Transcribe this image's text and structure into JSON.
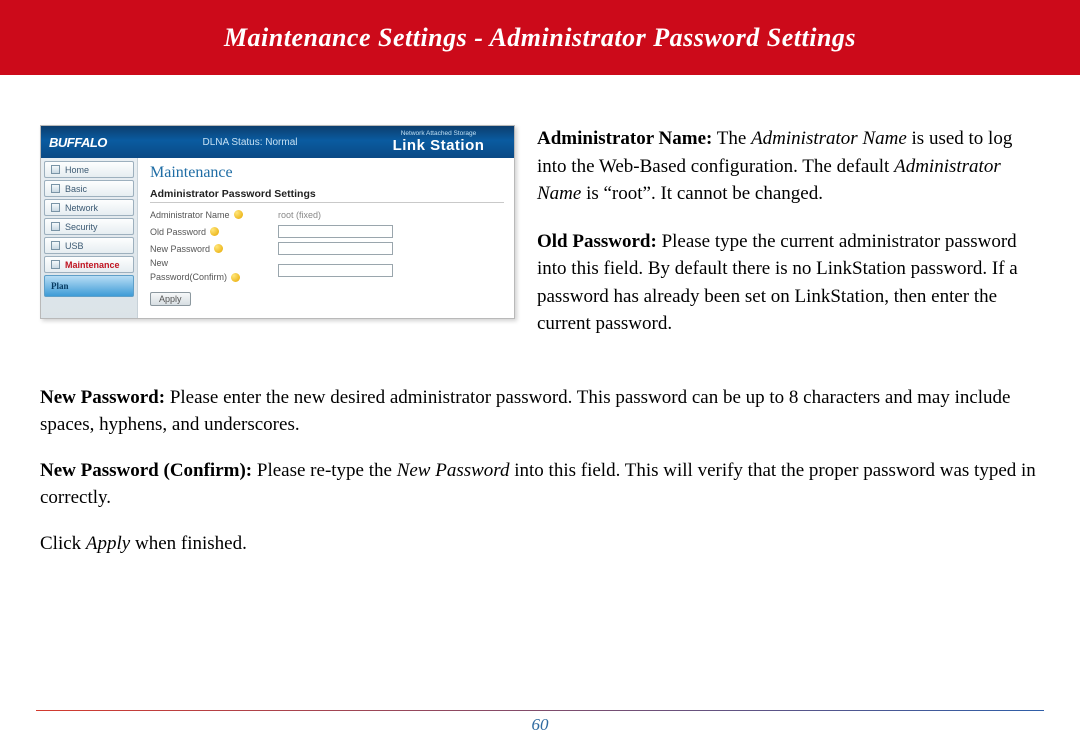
{
  "header": {
    "title": "Maintenance Settings - Administrator Password Settings"
  },
  "screenshot": {
    "logo": "BUFFALO",
    "status": "DLNA Status: Normal",
    "brand_small": "Network Attached Storage",
    "brand_big": "Link Station",
    "nav": {
      "home": "Home",
      "basic": "Basic",
      "network": "Network",
      "security": "Security",
      "usb": "USB",
      "maintenance": "Maintenance",
      "plan": "Plan"
    },
    "panel_title": "Maintenance",
    "section_title": "Administrator Password Settings",
    "rows": {
      "admin_name_label": "Administrator Name",
      "admin_name_value": "root (fixed)",
      "old_password_label": "Old Password",
      "new_password_label": "New Password",
      "confirm_label_line1": "New",
      "confirm_label_line2": "Password(Confirm)"
    },
    "apply_button": "Apply"
  },
  "descriptions": {
    "admin_name_bold": "Administrator Name:",
    "admin_name_text1": "  The ",
    "admin_name_italic1": "Administrator Name",
    "admin_name_text2": " is used to log into the Web-Based configuration.  The default ",
    "admin_name_italic2": "Administrator Name",
    "admin_name_text3": " is “root”.  It cannot be changed.",
    "old_pw_bold": "Old Password:",
    "old_pw_text": "  Please type the current administrator password into this field.  By default there is no LinkStation password.  If a password has already been set on LinkStation, then enter the current password.",
    "new_pw_bold": "New Password:",
    "new_pw_text": "  Please enter the new desired administrator password.  This password can be up to 8 characters and may include spaces, hyphens, and underscores.",
    "confirm_bold": "New Password (Confirm):",
    "confirm_text1": "  Please re-type the ",
    "confirm_italic": "New Password",
    "confirm_text2": " into this field.  This will verify that the proper password was typed in correctly.",
    "apply_text1": "Click ",
    "apply_italic": "Apply",
    "apply_text2": " when finished."
  },
  "footer": {
    "page_number": "60"
  }
}
